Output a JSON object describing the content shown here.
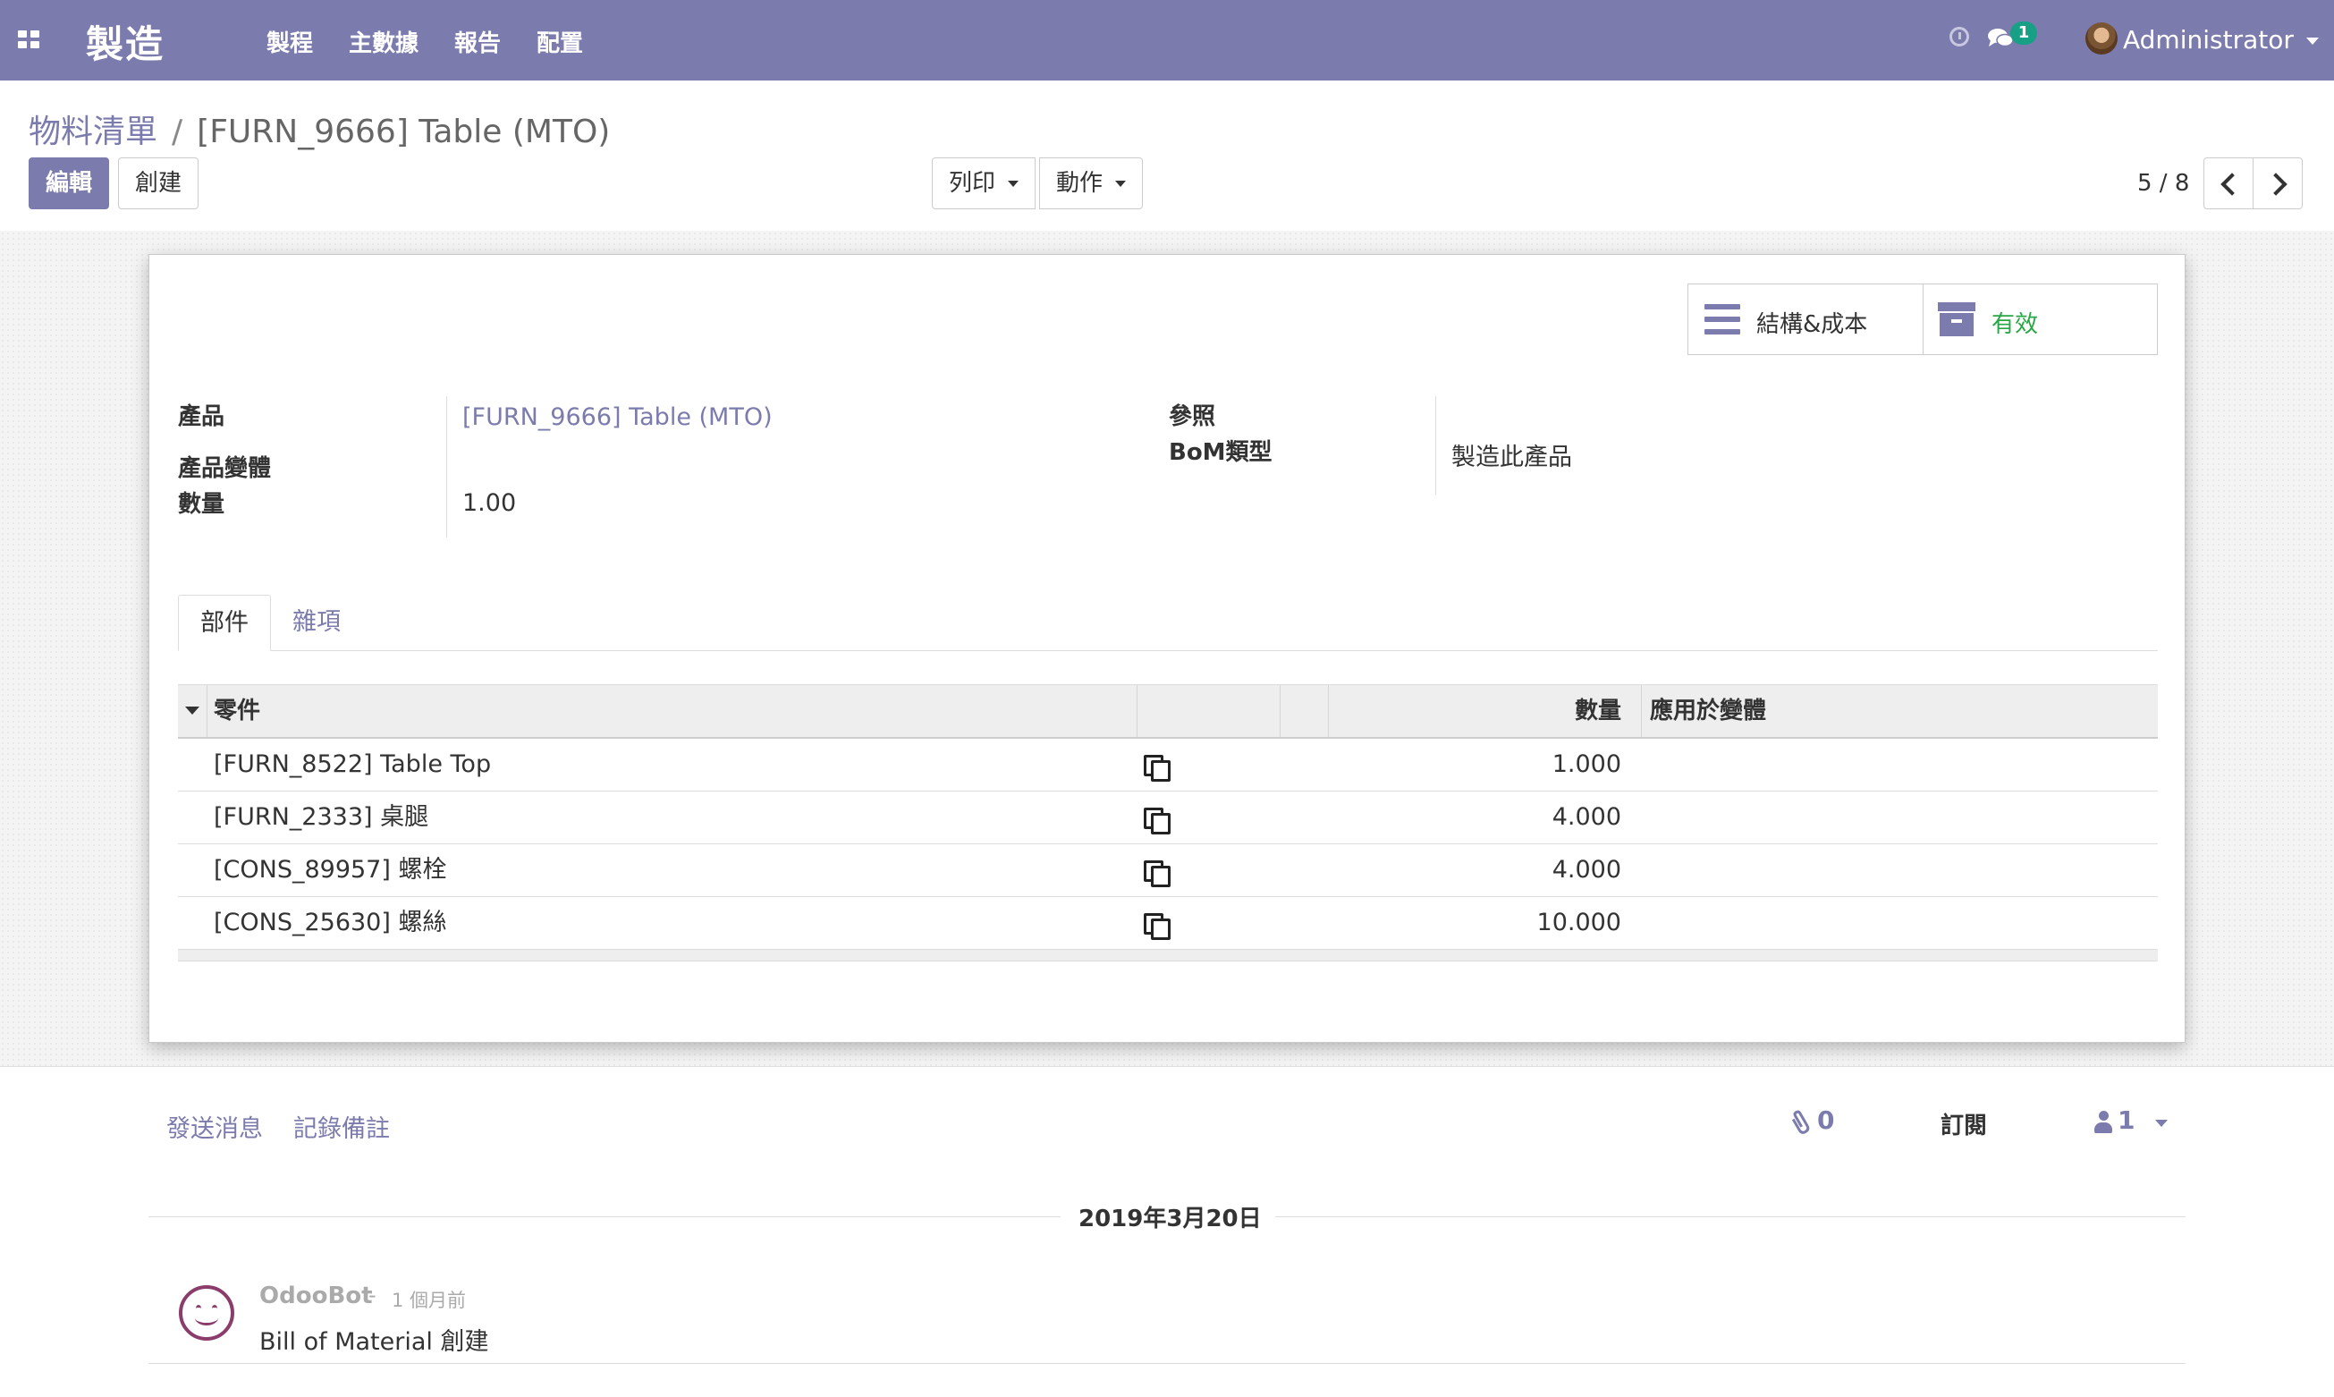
{
  "navbar": {
    "brand": "製造",
    "menu": [
      "製程",
      "主數據",
      "報告",
      "配置"
    ],
    "chat_count": "1",
    "user_name": "Administrator"
  },
  "control_panel": {
    "breadcrumb_root": "物料清單",
    "breadcrumb_separator": "/",
    "breadcrumb_current": "[FURN_9666] Table (MTO)",
    "edit_label": "編輯",
    "create_label": "創建",
    "print_label": "列印",
    "action_label": "動作",
    "pager": "5 / 8"
  },
  "smart_buttons": {
    "structure_label": "結構&成本",
    "active_label": "有效"
  },
  "form": {
    "product_label": "產品",
    "product_value": "[FURN_9666] Table (MTO)",
    "variant_label": "產品變體",
    "quantity_label": "數量",
    "quantity_value": "1.00",
    "reference_label": "參照",
    "bom_type_label": "BoM類型",
    "bom_type_value": "製造此產品"
  },
  "tabs": [
    "部件",
    "雜項"
  ],
  "components": {
    "headers": {
      "component": "零件",
      "quantity": "數量",
      "apply_variants": "應用於變體"
    },
    "rows": [
      {
        "name": "[FURN_8522] Table Top",
        "qty": "1.000"
      },
      {
        "name": "[FURN_2333] 桌腿",
        "qty": "4.000"
      },
      {
        "name": "[CONS_89957] 螺栓",
        "qty": "4.000"
      },
      {
        "name": "[CONS_25630] 螺絲",
        "qty": "10.000"
      }
    ]
  },
  "chatter": {
    "send_message": "發送消息",
    "log_note": "記錄備註",
    "attachments": "0",
    "follow": "訂閱",
    "followers": "1",
    "date_separator": "2019年3月20日",
    "message": {
      "author": "OdooBot",
      "dash": "-",
      "date": "1 個月前",
      "body": "Bill of Material 創建"
    }
  },
  "colors": {
    "brand": "#7c7bad",
    "active_green": "#28a745",
    "badge": "#18a086"
  },
  "icons": [
    "apps-icon",
    "clock-icon",
    "chat-icon",
    "avatar",
    "chevron-left-icon",
    "chevron-right-icon",
    "bars-icon",
    "archive-icon",
    "copy-icon",
    "paperclip-icon",
    "user-icon",
    "odoobot-avatar"
  ]
}
